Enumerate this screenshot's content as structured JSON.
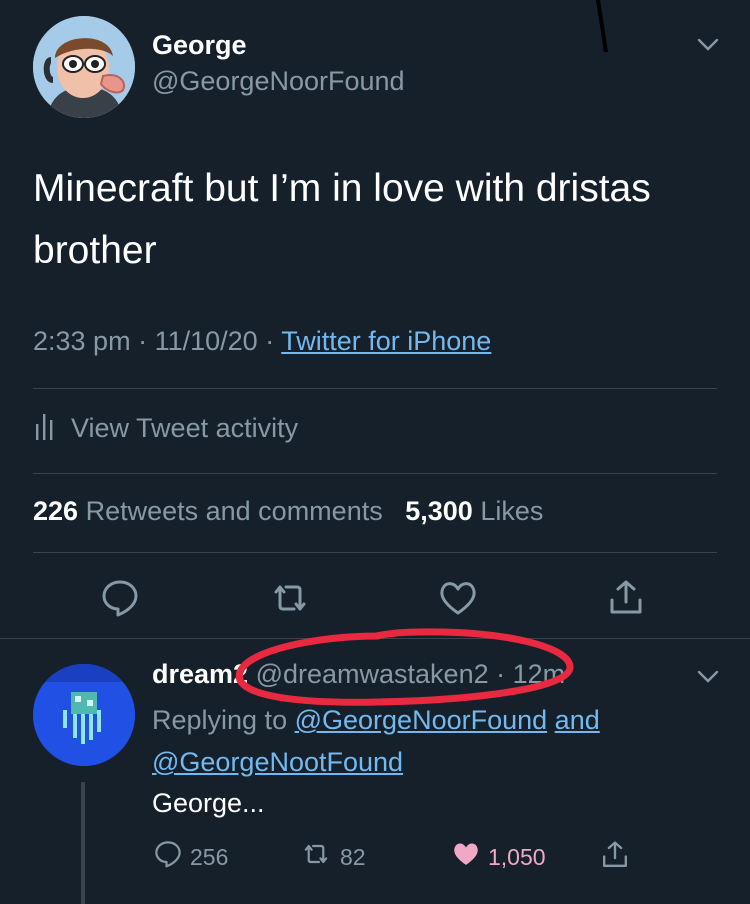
{
  "tweet": {
    "author_name": "George",
    "author_handle": "@GeorgeNoorFound",
    "text": "Minecraft but I’m in love with dristas brother",
    "time": "2:33 pm",
    "date": "11/10/20",
    "source": "Twitter for iPhone",
    "activity_label": "View Tweet activity",
    "retweets_count": "226",
    "retweets_label": "Retweets and comments",
    "likes_count": "5,300",
    "likes_label": "Likes"
  },
  "reply": {
    "author_name": "dream2",
    "author_handle": "@dreamwastaken2",
    "age": "12m",
    "replying_prefix": "Replying to",
    "replying_to_1": "@GeorgeNoorFound",
    "replying_and": "and",
    "replying_to_2": "@GeorgeNootFound",
    "text": "George...",
    "comments": "256",
    "retweets": "82",
    "likes": "1,050"
  },
  "colors": {
    "background": "#15202b",
    "secondary_text": "#8899a6",
    "link": "#73b9ef",
    "like": "#f0a8c4",
    "annotation": "#e8293f"
  },
  "icons": [
    "chevron-down-icon",
    "bar-chart-icon",
    "comment-icon",
    "retweet-icon",
    "heart-icon",
    "share-icon"
  ]
}
